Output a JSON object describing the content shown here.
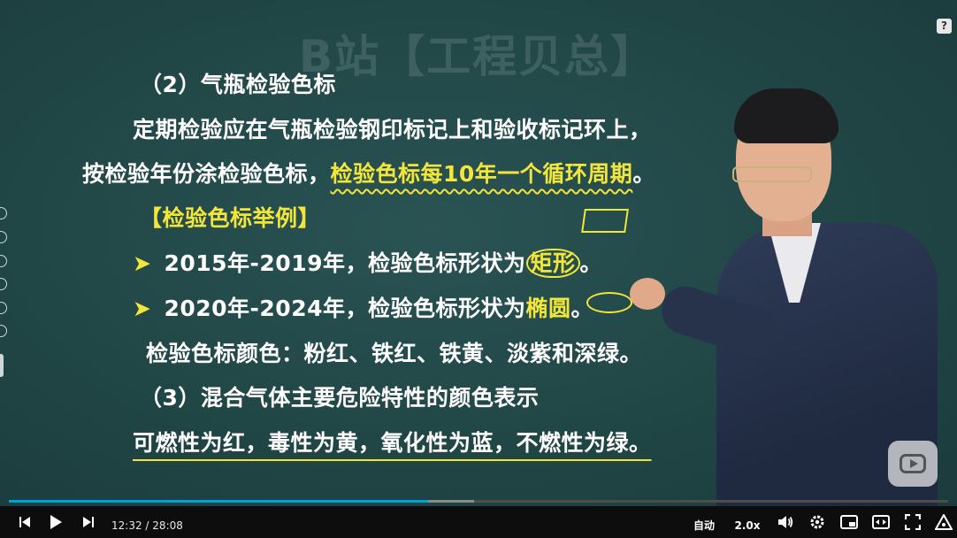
{
  "video": {
    "watermark": "B站【工程贝总】",
    "lines": {
      "l1": "（2）气瓶检验色标",
      "l2": "定期检验应在气瓶检验钢印标记上和验收标记环上，",
      "l3a": "按检验年份涂检验色标，",
      "l3b": "检验色标每10年一个循环周期",
      "l3c": "。",
      "l4": "【检验色标举例】",
      "l5a": "2015年-2019年，检验色标形状为",
      "l5b": "矩形",
      "l5c": "。",
      "l6a": "2020年-2024年，检验色标形状为",
      "l6b": "椭圆",
      "l6c": "。",
      "l7": "检验色标颜色：粉红、铁红、铁黄、淡紫和深绿。",
      "l8": "（3）混合气体主要危险特性的颜色表示",
      "l9": "可燃性为红，毒性为黄，氧化性为蓝，不燃性为绿。"
    },
    "bullet": "➤",
    "help": "?",
    "colors": {
      "board": "#214646",
      "highlight": "#f2e63a",
      "text": "#ffffff",
      "progress": "#00a1d6"
    }
  },
  "controls": {
    "current_time": "12:32",
    "separator": "/",
    "duration": "28:08",
    "played_fraction": 0.446,
    "quality": "自动",
    "speed": "2.0x",
    "icons": [
      "prev-icon",
      "play-icon",
      "next-icon",
      "volume-icon",
      "settings-icon",
      "pip-icon",
      "widescreen-icon",
      "fullscreen-icon",
      "danmaku-icon"
    ]
  }
}
